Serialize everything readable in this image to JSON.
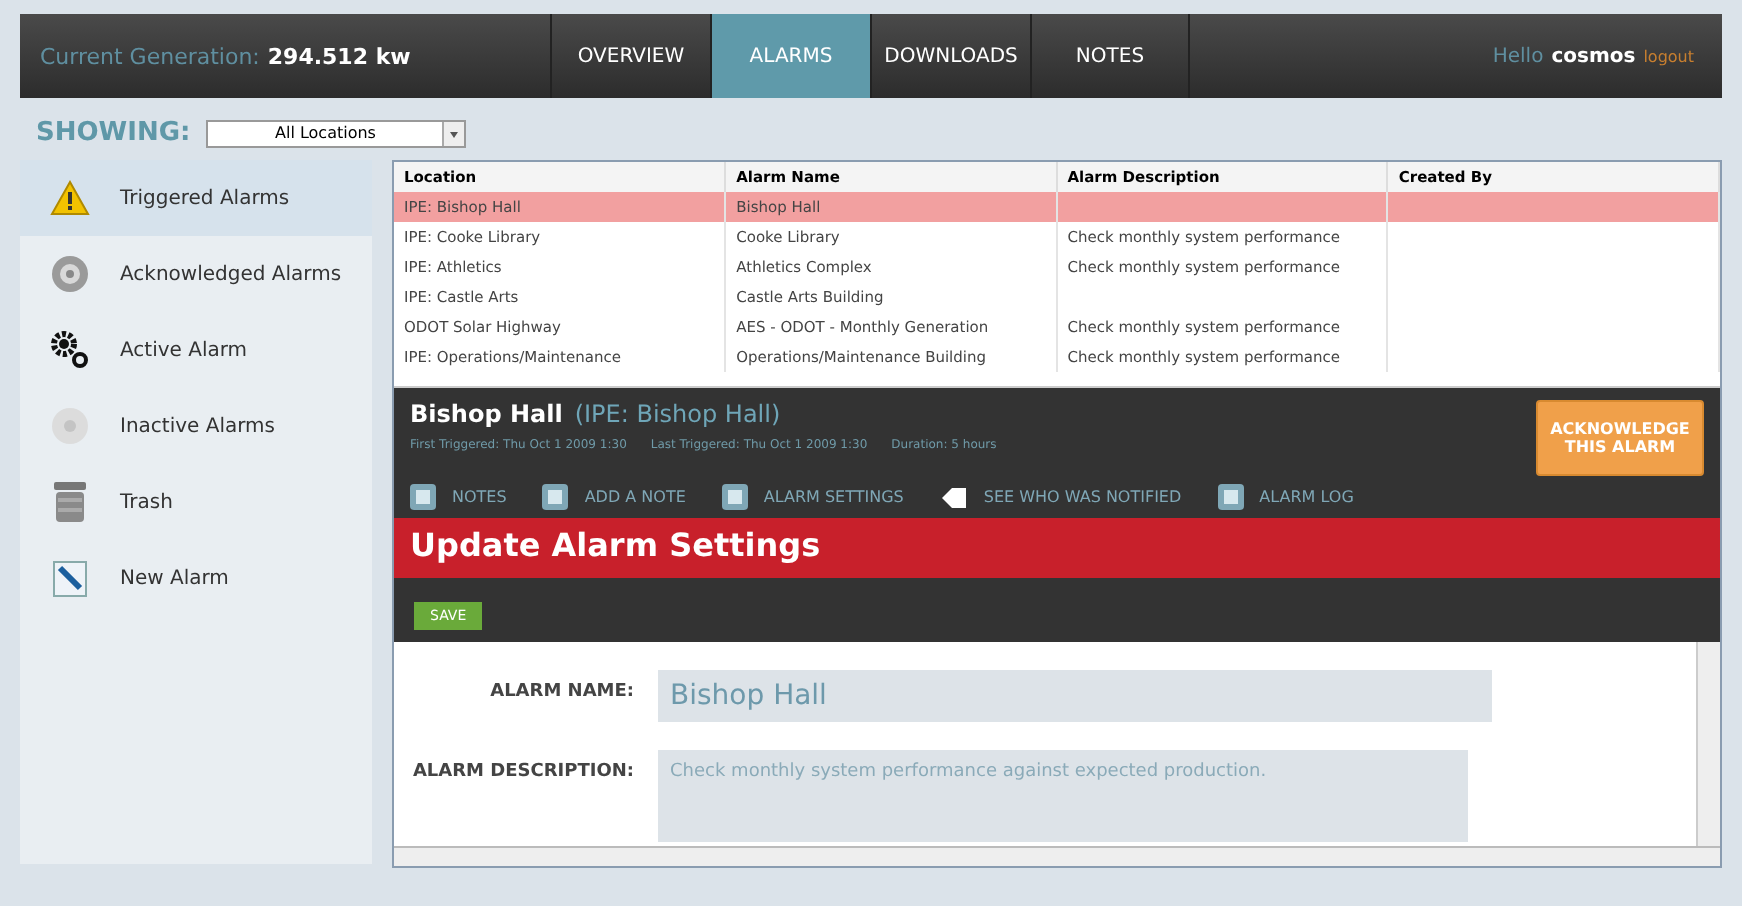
{
  "header": {
    "generation_label": "Current Generation:",
    "generation_value": "294.512 kw",
    "tabs": [
      {
        "label": "OVERVIEW",
        "selected": false
      },
      {
        "label": "ALARMS",
        "selected": true
      },
      {
        "label": "DOWNLOADS",
        "selected": false
      },
      {
        "label": "NOTES",
        "selected": false
      }
    ],
    "greeting": "Hello",
    "username": "cosmos",
    "logout": "logout"
  },
  "filter": {
    "label": "SHOWING:",
    "value": "All Locations"
  },
  "sidebar": {
    "items": [
      {
        "label": "Triggered Alarms",
        "selected": true
      },
      {
        "label": "Acknowledged Alarms",
        "selected": false
      },
      {
        "label": "Active Alarm",
        "selected": false
      },
      {
        "label": "Inactive Alarms",
        "selected": false
      },
      {
        "label": "Trash",
        "selected": false
      },
      {
        "label": "New Alarm",
        "selected": false
      }
    ]
  },
  "table": {
    "columns": [
      "Location",
      "Alarm Name",
      "Alarm Description",
      "Created By"
    ],
    "rows": [
      {
        "cells": [
          "IPE: Bishop Hall",
          "Bishop Hall",
          "",
          ""
        ],
        "selected": true
      },
      {
        "cells": [
          "IPE: Cooke Library",
          "Cooke Library",
          "Check monthly system performance",
          ""
        ],
        "selected": false
      },
      {
        "cells": [
          "IPE: Athletics",
          "Athletics Complex",
          "Check monthly system performance",
          ""
        ],
        "selected": false
      },
      {
        "cells": [
          "IPE: Castle Arts",
          "Castle Arts Building",
          "",
          ""
        ],
        "selected": false
      },
      {
        "cells": [
          "ODOT Solar Highway",
          "AES - ODOT - Monthly Generation",
          "Check monthly system performance",
          ""
        ],
        "selected": false
      },
      {
        "cells": [
          "IPE: Operations/Maintenance",
          "Operations/Maintenance Building",
          "Check monthly system performance",
          ""
        ],
        "selected": false
      }
    ]
  },
  "detail": {
    "title": "Bishop Hall",
    "subtitle": "(IPE: Bishop Hall)",
    "meta": [
      {
        "label": "First Triggered:",
        "value": "Thu Oct 1 2009 1:30"
      },
      {
        "label": "Last Triggered:",
        "value": "Thu Oct 1 2009 1:30"
      },
      {
        "label": "Duration:",
        "value": "5 hours"
      }
    ],
    "acknowledge_button": "ACKNOWLEDGE THIS ALARM",
    "actions": [
      "NOTES",
      "ADD A NOTE",
      "ALARM SETTINGS",
      "SEE WHO WAS NOTIFIED",
      "ALARM LOG"
    ],
    "section_title": "Update Alarm Settings",
    "save_button": "SAVE",
    "fields": [
      {
        "label": "ALARM NAME:",
        "value": "Bishop Hall",
        "kind": "input"
      },
      {
        "label": "ALARM DESCRIPTION:",
        "value": "Check monthly system performance against expected production.",
        "kind": "textarea"
      }
    ]
  }
}
